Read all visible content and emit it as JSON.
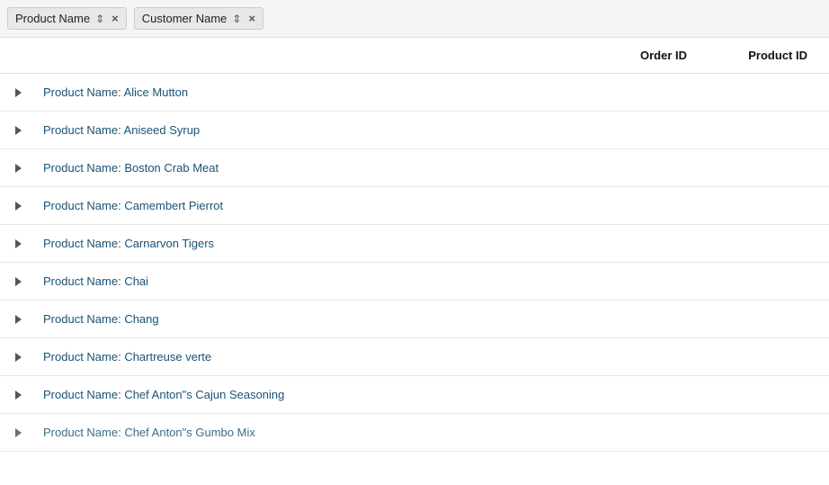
{
  "filterBar": {
    "filters": [
      {
        "id": "product-name-filter",
        "label": "Product Name",
        "filterIcon": "≡",
        "closeLabel": "×"
      },
      {
        "id": "customer-name-filter",
        "label": "Customer Name",
        "filterIcon": "≡",
        "closeLabel": "×"
      }
    ]
  },
  "table": {
    "columns": [
      {
        "id": "order-id",
        "label": "Order ID"
      },
      {
        "id": "product-id",
        "label": "Product ID"
      }
    ],
    "rows": [
      {
        "id": 1,
        "label": "Product Name: Alice Mutton"
      },
      {
        "id": 2,
        "label": "Product Name: Aniseed Syrup"
      },
      {
        "id": 3,
        "label": "Product Name: Boston Crab Meat"
      },
      {
        "id": 4,
        "label": "Product Name: Camembert Pierrot"
      },
      {
        "id": 5,
        "label": "Product Name: Carnarvon Tigers"
      },
      {
        "id": 6,
        "label": "Product Name: Chai"
      },
      {
        "id": 7,
        "label": "Product Name: Chang"
      },
      {
        "id": 8,
        "label": "Product Name: Chartreuse verte"
      },
      {
        "id": 9,
        "label": "Product Name: Chef Anton\"s Cajun Seasoning"
      },
      {
        "id": 10,
        "label": "Product Name: Chef Anton\"s Gumbo Mix",
        "partial": true
      }
    ]
  }
}
